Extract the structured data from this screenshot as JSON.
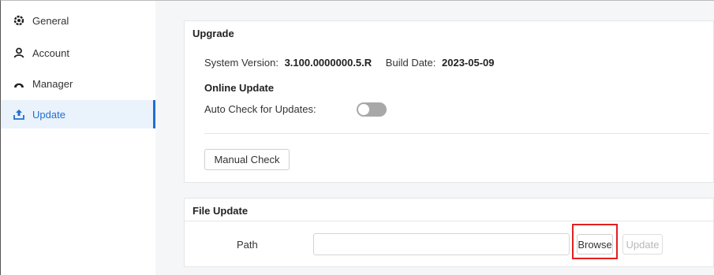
{
  "sidebar": {
    "items": [
      {
        "label": "General",
        "icon": "gear-icon"
      },
      {
        "label": "Account",
        "icon": "user-icon"
      },
      {
        "label": "Manager",
        "icon": "manager-icon"
      },
      {
        "label": "Update",
        "icon": "upload-icon",
        "active": true
      }
    ]
  },
  "upgrade": {
    "title": "Upgrade",
    "system_version_label": "System Version:",
    "system_version_value": "3.100.0000000.5.R",
    "build_date_label": "Build Date:",
    "build_date_value": "2023-05-09",
    "online_update_heading": "Online Update",
    "auto_check_label": "Auto Check for Updates:",
    "auto_check_enabled": false,
    "manual_check_label": "Manual Check"
  },
  "file_update": {
    "title": "File Update",
    "path_label": "Path",
    "path_value": "",
    "browse_label": "Browse",
    "update_label": "Update"
  },
  "colors": {
    "accent": "#1f6fd0",
    "highlight": "#e02020",
    "toggle_off": "#a8a8a8"
  }
}
